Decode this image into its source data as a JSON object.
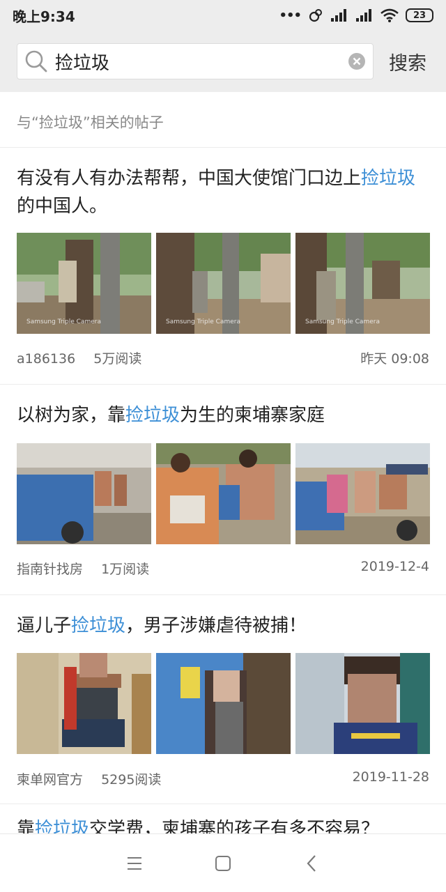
{
  "status": {
    "time": "晚上9:34",
    "battery": "23"
  },
  "search": {
    "query": "捡垃圾",
    "button_label": "搜索"
  },
  "section_hint": "与“捡垃圾”相关的帖子",
  "posts": [
    {
      "title_parts": [
        "有没有人有办法帮帮，中国大使馆门口边上",
        "捡垃圾",
        "的中国人。"
      ],
      "author": "a186136",
      "reads": "5万阅读",
      "time": "昨天 09:08",
      "image_watermark": "Samsung Triple Camera"
    },
    {
      "title_parts": [
        "以树为家，靠",
        "捡垃圾",
        "为生的柬埔寨家庭"
      ],
      "author": "指南针找房",
      "reads": "1万阅读",
      "time": "2019-12-4"
    },
    {
      "title_parts": [
        "逼儿子",
        "捡垃圾",
        "，男子涉嫌虐待被捕！"
      ],
      "author": "柬单网官方",
      "reads": "5295阅读",
      "time": "2019-11-28"
    }
  ],
  "peek_post": {
    "title_parts": [
      "靠",
      "捡垃圾",
      "交学费，柬埔寨的孩子有多不容易？"
    ]
  },
  "colors": {
    "highlight": "#3d8fd6",
    "header_bg": "#ededed"
  },
  "icons": [
    "search-icon",
    "clear-icon",
    "menu-icon",
    "home-icon",
    "back-icon",
    "wifi-icon",
    "signal-icon"
  ]
}
